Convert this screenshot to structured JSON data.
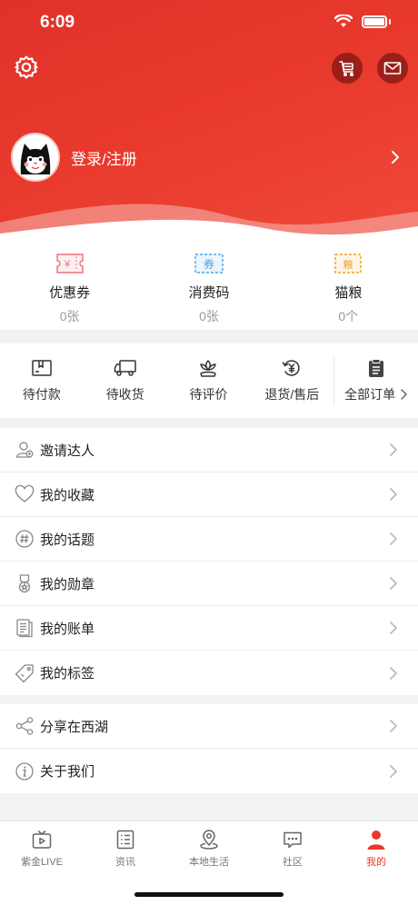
{
  "status": {
    "time": "6:09"
  },
  "header": {
    "login_label": "登录/注册"
  },
  "assets": [
    {
      "label": "优惠券",
      "value": "0张",
      "icon": "coupon-icon",
      "glyph": "¥"
    },
    {
      "label": "消费码",
      "value": "0张",
      "icon": "ticket-icon",
      "glyph": "券"
    },
    {
      "label": "猫粮",
      "value": "0个",
      "icon": "cat-food-icon",
      "glyph": "粮"
    }
  ],
  "orders": [
    {
      "label": "待付款",
      "icon": "wallet-icon"
    },
    {
      "label": "待收货",
      "icon": "truck-icon"
    },
    {
      "label": "待评价",
      "icon": "flower-icon"
    },
    {
      "label": "退货/售后",
      "icon": "refund-icon"
    },
    {
      "label": "全部订单",
      "icon": "clipboard-icon"
    }
  ],
  "menu1": [
    {
      "label": "邀请达人",
      "icon": "invite-user-icon"
    },
    {
      "label": "我的收藏",
      "icon": "heart-icon"
    },
    {
      "label": "我的话题",
      "icon": "hashtag-icon"
    },
    {
      "label": "我的勋章",
      "icon": "medal-icon"
    },
    {
      "label": "我的账单",
      "icon": "bill-icon"
    },
    {
      "label": "我的标签",
      "icon": "tag-icon"
    }
  ],
  "menu2": [
    {
      "label": "分享在西湖",
      "icon": "share-icon"
    },
    {
      "label": "关于我们",
      "icon": "info-icon"
    }
  ],
  "tabs": [
    {
      "label": "紫金LIVE",
      "icon": "tv-icon",
      "active": false
    },
    {
      "label": "资讯",
      "icon": "news-icon",
      "active": false
    },
    {
      "label": "本地生活",
      "icon": "location-icon",
      "active": false
    },
    {
      "label": "社区",
      "icon": "chat-icon",
      "active": false
    },
    {
      "label": "我的",
      "icon": "person-icon",
      "active": true
    }
  ],
  "colors": {
    "brand_red": "#e8392c",
    "coupon": "#e8747a",
    "ticket": "#4aa3e0",
    "cat_food": "#f0a020"
  }
}
